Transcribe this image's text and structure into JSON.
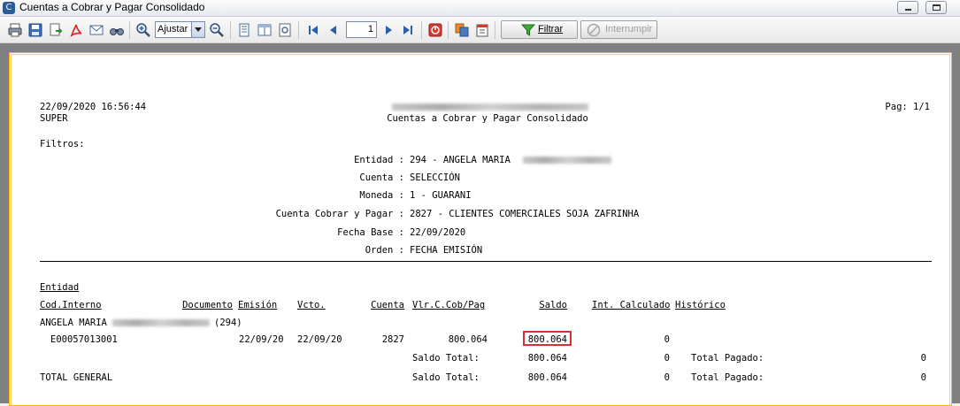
{
  "window": {
    "title": "Cuentas a Cobrar y Pagar Consolidado"
  },
  "toolbar": {
    "zoom_value": "Ajustar a",
    "page_value": "1",
    "filter_label": "Filtrar",
    "interrupt_label": "Interrumpir",
    "icons": [
      "printer-icon",
      "save-icon",
      "export-icon",
      "pdf-icon",
      "email-icon",
      "find-icon",
      "zoom-in-icon",
      "zoom-out-icon",
      "single-page-icon",
      "two-page-icon",
      "settings-icon",
      "first-page-icon",
      "prev-page-icon",
      "next-page-icon",
      "last-page-icon",
      "stop-icon",
      "copy-icon",
      "report-icon",
      "funnel-icon",
      "interrupt-icon"
    ]
  },
  "report": {
    "datetime": "22/09/2020 16:56:44",
    "user": "SUPER",
    "title": "Cuentas a Cobrar y Pagar Consolidado",
    "page": "Pag: 1/1",
    "filters_label": "Filtros:",
    "filters": [
      {
        "label": "Entidad :",
        "value": "294 - ANGELA MARIA"
      },
      {
        "label": "Cuenta :",
        "value": "SELECCIÓN"
      },
      {
        "label": "Moneda :",
        "value": "1 - GUARANI"
      },
      {
        "label": "Cuenta Cobrar y Pagar :",
        "value": "2827 - CLIENTES COMERCIALES SOJA ZAFRINHA"
      },
      {
        "label": "Fecha Base :",
        "value": "22/09/2020"
      },
      {
        "label": "Orden :",
        "value": "FECHA EMISIÓN"
      }
    ],
    "group_header": "Entidad",
    "columns": {
      "cod_interno": "Cod.Interno",
      "documento": "Documento",
      "emision": "Emisión",
      "vcto": "Vcto.",
      "cuenta": "Cuenta",
      "vlr": "Vlr.C.Cob/Pag",
      "saldo": "Saldo",
      "int_calculado": "Int. Calculado",
      "historico": "Histórico"
    },
    "entity_name": "ANGELA MARIA",
    "entity_code": "(294)",
    "row": {
      "cod_interno": "E00057013001",
      "emision": "22/09/20",
      "vcto": "22/09/20",
      "cuenta": "2827",
      "vlr": "800.064",
      "saldo": "800.064",
      "int_calculado": "0"
    },
    "subtotal": {
      "saldo_label": "Saldo Total:",
      "saldo": "800.064",
      "int": "0",
      "pagado_label": "Total Pagado:",
      "pagado": "0"
    },
    "total": {
      "label": "TOTAL GENERAL",
      "saldo_label": "Saldo Total:",
      "saldo": "800.064",
      "int": "0",
      "pagado_label": "Total Pagado:",
      "pagado": "0"
    }
  }
}
